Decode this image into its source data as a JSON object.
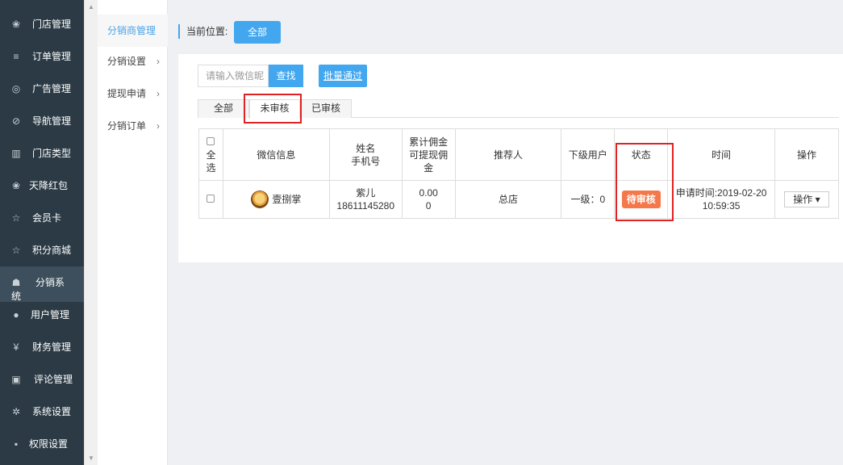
{
  "sidebar": {
    "items": [
      {
        "label": "门店管理",
        "icon": "stores-icon",
        "glyph": "❀"
      },
      {
        "label": "订单管理",
        "icon": "list-icon",
        "glyph": "≡"
      },
      {
        "label": "广告管理",
        "icon": "lifebuoy-icon",
        "glyph": "◎"
      },
      {
        "label": "导航管理",
        "icon": "compass-icon",
        "glyph": "⊘"
      },
      {
        "label": "门店类型",
        "icon": "bank-icon",
        "glyph": "▥"
      },
      {
        "label": "天降红包",
        "icon": "redpacket-icon",
        "glyph": "❀"
      },
      {
        "label": "会员卡",
        "icon": "star-icon",
        "glyph": "☆"
      },
      {
        "label": "积分商城",
        "icon": "star-icon",
        "glyph": "☆"
      },
      {
        "label": "分销系",
        "label2": "统",
        "icon": "users-icon",
        "glyph": "☗"
      },
      {
        "label": "用户管理",
        "icon": "user-icon",
        "glyph": "●"
      },
      {
        "label": "财务管理",
        "icon": "yen-icon",
        "glyph": "¥"
      },
      {
        "label": "评论管理",
        "icon": "comment-icon",
        "glyph": "▣"
      },
      {
        "label": "系统设置",
        "icon": "gear-icon",
        "glyph": "✲"
      },
      {
        "label": "权限设置",
        "icon": "lock-icon",
        "glyph": "▪"
      }
    ]
  },
  "submenu": {
    "items": [
      {
        "label": "分销商管理",
        "arrow": ""
      },
      {
        "label": "分销设置",
        "arrow": "›"
      },
      {
        "label": "提现申请",
        "arrow": "›"
      },
      {
        "label": "分销订单",
        "arrow": "›"
      }
    ]
  },
  "breadcrumb": {
    "label": "当前位置:",
    "button": "全部"
  },
  "search": {
    "placeholder": "请输入微信昵",
    "button": "查找"
  },
  "batch_button": "批量通过",
  "tabs": [
    "全部",
    "未审核",
    "已审核"
  ],
  "table": {
    "headers": {
      "select_all": [
        "全",
        "选"
      ],
      "wechat": "微信信息",
      "name_phone": [
        "姓名",
        "手机号"
      ],
      "commission": [
        "累计佣金",
        "可提现佣",
        "金"
      ],
      "referrer": "推荐人",
      "subordinate": "下级用户",
      "status": "状态",
      "time": "时间",
      "action": "操作"
    },
    "rows": [
      {
        "wechat_name": "壹捌掌",
        "name": "紫儿",
        "phone": "18611145280",
        "commission_total": "0.00",
        "commission_withdrawable": "0",
        "referrer": "总店",
        "subordinate": "一级：0",
        "status": "待审核",
        "time_line1": "申请时间:2019-02-20",
        "time_line2": "10:59:35",
        "action": "操作"
      }
    ]
  },
  "colors": {
    "sidebar": "#2b3a45",
    "accent": "#43a7ef",
    "status": "#f5784a",
    "highlight": "#e02222"
  }
}
